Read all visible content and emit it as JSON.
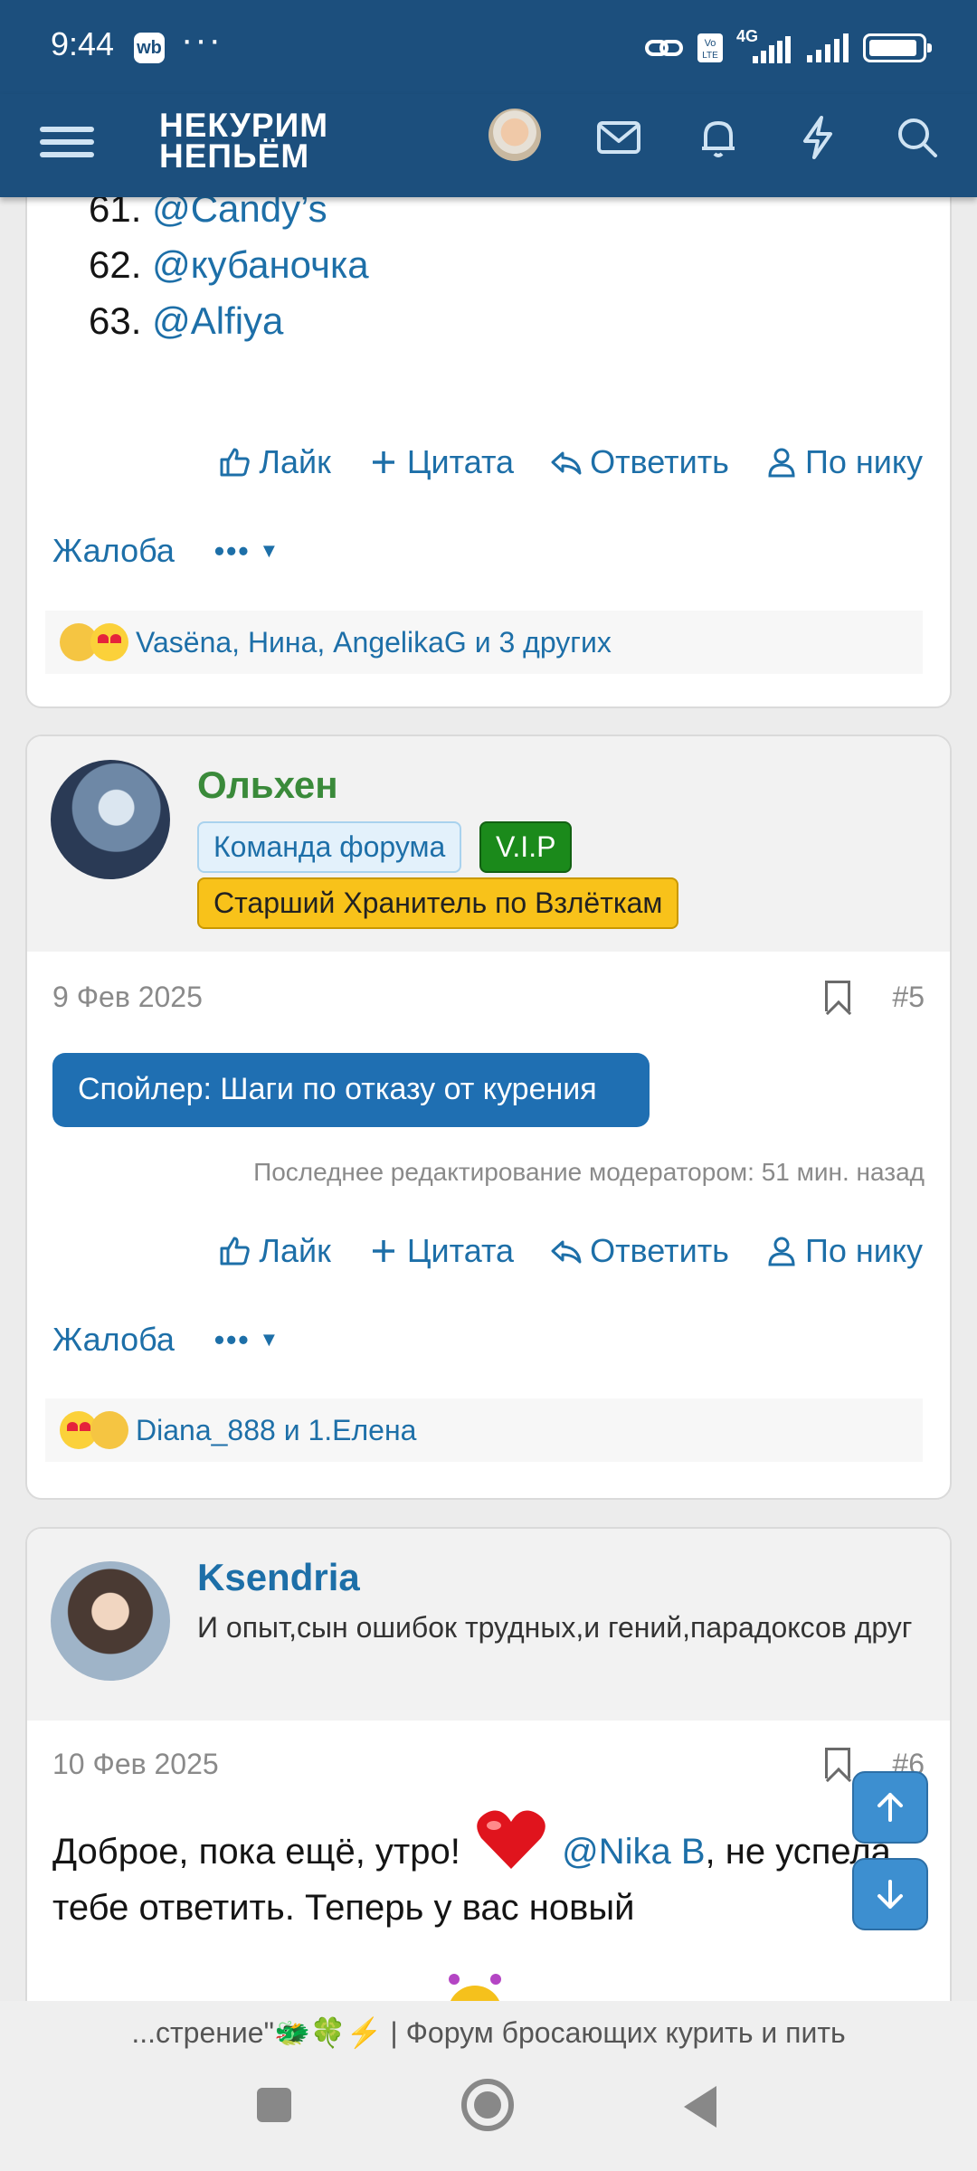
{
  "status_bar": {
    "time": "9:44",
    "app_badge": "wb",
    "more": "···",
    "net": "4G"
  },
  "header": {
    "logo_line1": "НЕКУРИМ",
    "logo_line2": "НЕПЬЁМ"
  },
  "post1": {
    "list": [
      {
        "num": "61.",
        "user": "@Candy’s"
      },
      {
        "num": "62.",
        "user": "@кубаночка"
      },
      {
        "num": "63.",
        "user": "@Alfiya"
      }
    ],
    "reactions_text": "Vasёna, Нина, AngelikaG и 3 других"
  },
  "actions": {
    "like": "Лайк",
    "quote": "Цитата",
    "reply": "Ответить",
    "by_nick": "По нику",
    "report": "Жалоба",
    "more": "•••"
  },
  "post2": {
    "username": "Ольхен",
    "badges": [
      "Команда форума",
      "V.I.P",
      "Старший Хранитель по Взлёткам"
    ],
    "date": "9 Фев 2025",
    "number": "#5",
    "spoiler": "Спойлер: Шаги по отказу от курения",
    "last_edit": "Последнее редактирование модератором: 51 мин. назад",
    "reactions_text": "Diana_888 и 1.Елена",
    "colors": {
      "username": "#3a8a3a",
      "vip": "#1b8a1b",
      "keeper": "#f8c21a"
    }
  },
  "post3": {
    "username": "Ksendria",
    "user_title": "И опыт,сын ошибок трудных,и гений,парадоксов друг",
    "date": "10 Фев 2025",
    "number": "#6",
    "text_part1": "Доброе, пока ещё, утро!",
    "mention": "@Nika B",
    "text_part2": ", не успела тебе ответить. Теперь у вас новый"
  },
  "footer": {
    "title": "...стрение\"🐲🍀⚡ | Форум бросающих курить и пить"
  }
}
